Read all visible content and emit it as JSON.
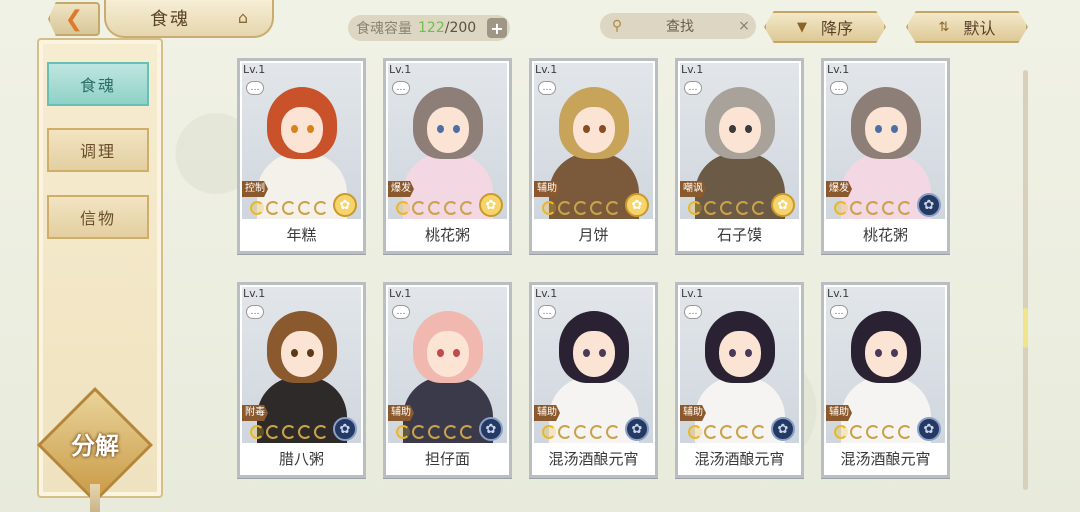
{
  "header": {
    "back_icon": "back-arrow-icon",
    "title": "食魂",
    "capacity_label": "食魂容量",
    "capacity_current": "122",
    "capacity_max": "/200",
    "add_label": "+",
    "search_label": "查找",
    "search_clear": "×",
    "sort_desc_label": "降序",
    "sort_default_label": "默认"
  },
  "sidebar": {
    "items": [
      {
        "label": "食魂",
        "active": true
      },
      {
        "label": "调理",
        "active": false
      },
      {
        "label": "信物",
        "active": false
      }
    ],
    "decompose_label": "分解"
  },
  "cards": [
    {
      "level": "Lv.1",
      "name": "年糕",
      "role": "控制",
      "type": "gold",
      "hair": "#c9522a",
      "body": "#f4f0ea",
      "eye": "#d9821c"
    },
    {
      "level": "Lv.1",
      "name": "桃花粥",
      "role": "爆发",
      "type": "gold",
      "hair": "#8e7e78",
      "body": "#f3d7e2",
      "eye": "#4d6fa6"
    },
    {
      "level": "Lv.1",
      "name": "月饼",
      "role": "辅助",
      "type": "gold",
      "hair": "#c8a35a",
      "body": "#7b5a3b",
      "eye": "#8a4a22"
    },
    {
      "level": "Lv.1",
      "name": "石子馍",
      "role": "嘲讽",
      "type": "gold",
      "hair": "#a8a29a",
      "body": "#6b5a45",
      "eye": "#3b3b3b"
    },
    {
      "level": "Lv.1",
      "name": "桃花粥",
      "role": "爆发",
      "type": "blue",
      "hair": "#8e7e78",
      "body": "#f3d7e2",
      "eye": "#4d6fa6"
    },
    {
      "level": "Lv.1",
      "name": "腊八粥",
      "role": "附毒",
      "type": "blue",
      "hair": "#8a5a2e",
      "body": "#2e2a2a",
      "eye": "#5b3a1a"
    },
    {
      "level": "Lv.1",
      "name": "担仔面",
      "role": "辅助",
      "type": "blue",
      "hair": "#f1b8b0",
      "body": "#3b3a4a",
      "eye": "#c04a4a"
    },
    {
      "level": "Lv.1",
      "name": "混汤酒酿元宵",
      "role": "辅助",
      "type": "blue",
      "hair": "#2a2232",
      "body": "#f6f4f2",
      "eye": "#4a3a5a"
    },
    {
      "level": "Lv.1",
      "name": "混汤酒酿元宵",
      "role": "辅助",
      "type": "blue",
      "hair": "#2a2232",
      "body": "#f6f4f2",
      "eye": "#4a3a5a"
    },
    {
      "level": "Lv.1",
      "name": "混汤酒酿元宵",
      "role": "辅助",
      "type": "blue",
      "hair": "#2a2232",
      "body": "#f6f4f2",
      "eye": "#4a3a5a"
    }
  ]
}
